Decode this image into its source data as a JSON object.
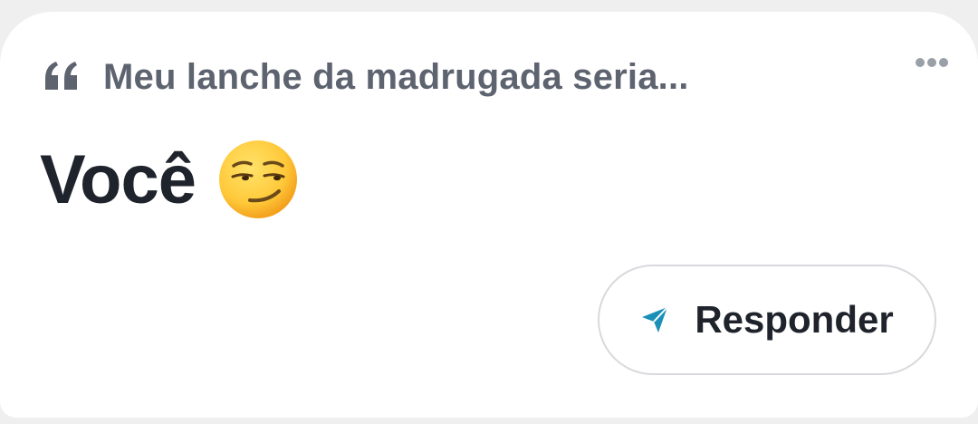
{
  "card": {
    "prompt": "Meu lanche da madrugada seria...",
    "answer": "Você",
    "answer_emoji": "smirking-face-emoji",
    "reply_label": "Responder"
  },
  "icons": {
    "quote": "quote-icon",
    "more": "more-options-icon",
    "send": "send-icon"
  },
  "colors": {
    "background": "#efefef",
    "card": "#ffffff",
    "prompt_text": "#5d6470",
    "answer_text": "#1f232b",
    "send_icon": "#1a8fb8",
    "button_border": "#d7d9dc"
  }
}
